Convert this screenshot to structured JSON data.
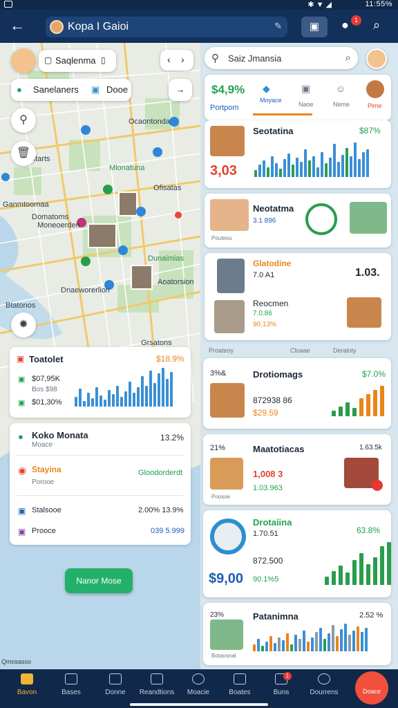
{
  "status_bar": {
    "time": "11:55%"
  },
  "app_bar": {
    "title": "Kopa I Gaioi",
    "notification_count": "1"
  },
  "map": {
    "search_chip": "Saqlenma",
    "filter_chip": {
      "label_a": "Sanelaners",
      "label_b": "Dooe"
    },
    "labels": [
      {
        "text": "Ocaontonda"
      },
      {
        "text": "Galtarts"
      },
      {
        "text": "Mlonatuna"
      },
      {
        "text": "Domatoms"
      },
      {
        "text": "Ofisatas"
      },
      {
        "text": "Ganmtoomaa"
      },
      {
        "text": "Moneoerden"
      },
      {
        "text": "Dunaimias"
      },
      {
        "text": "Aoatorsion"
      },
      {
        "text": "Dnaeworerlion"
      },
      {
        "text": "Btatonos"
      },
      {
        "text": "Grsatons"
      }
    ],
    "watermark": "Qmosasso"
  },
  "left_stats_card": {
    "title": "Toatolet",
    "value_right": "$18.9%",
    "rows": [
      {
        "label": "$07,95K"
      },
      {
        "label": "Bos $98"
      },
      {
        "label": "$01,30%"
      }
    ]
  },
  "left_list_card": {
    "item1": {
      "title": "Koko Monata",
      "sub": "Moace",
      "value": "13.2%"
    },
    "item2": {
      "title": "Stayina",
      "sub": "Porooe",
      "value": "Gloodorderdt"
    },
    "item3": {
      "title": "Stalsooe",
      "value": "2.00% 13.9%"
    },
    "item4": {
      "title": "Prooce",
      "value": "039 5.999"
    }
  },
  "cta_label": "Nanor Mose",
  "right_panel": {
    "search_placeholder": "Saiz Jmansia",
    "tabs_card": {
      "stat_value": "$4,9%",
      "stat_label": "Portpom",
      "tabs": [
        "Moyace",
        "Naoe",
        "Neme",
        "Pime"
      ],
      "active_tab": "Moyace"
    },
    "card1": {
      "title": "Seotatina",
      "value": "3,03",
      "pct": "$87%"
    },
    "card2": {
      "title": "Neotatma",
      "sub": "3.1 896",
      "caption": "Pouteou"
    },
    "card3": {
      "title": "Glatodine",
      "sub": "7.0 A1",
      "value": "1.03.",
      "title2": "Reocmen",
      "sub2": "7.0.86",
      "pct2": "90.13%"
    },
    "header_row": {
      "a": "Proateoy",
      "b": "Cloaae",
      "c": "Deraloty"
    },
    "card4": {
      "pct_left": "3%&",
      "title": "Drotiomags",
      "pct": "$7.0%",
      "value": "872938 86",
      "value2": "$29.59"
    },
    "card5": {
      "pct_left": "21%",
      "title": "Maatotiacas",
      "value": "1.63.5k",
      "value2": "1,008 3",
      "value3": "1.03.963",
      "caption": "Poosoe"
    },
    "card6": {
      "title": "Drotaiina",
      "sub": "1.70.51",
      "pct": "63.8%",
      "sub2": "872.500",
      "value": "$9,00",
      "value2": "90.1%5"
    },
    "card7": {
      "pct_left": "23%",
      "title": "Patanimna",
      "value": "2.52 %",
      "caption": "Botaosnal"
    }
  },
  "bottom_nav": {
    "items": [
      "Bavon",
      "Bases",
      "Donne",
      "Reandtions",
      "Moacie",
      "Boates",
      "Buns",
      "Dourrens"
    ],
    "fab_label": "Doace",
    "nav_badge": "1"
  }
}
